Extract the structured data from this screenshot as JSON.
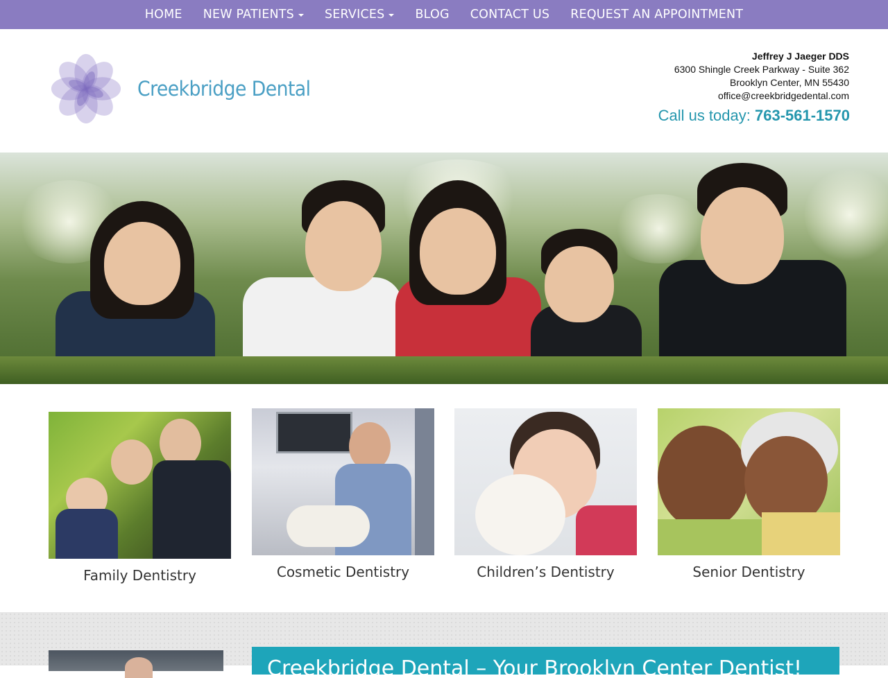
{
  "nav": {
    "items": [
      {
        "label": "HOME",
        "dropdown": false
      },
      {
        "label": "NEW PATIENTS",
        "dropdown": true
      },
      {
        "label": "SERVICES",
        "dropdown": true
      },
      {
        "label": "BLOG",
        "dropdown": false
      },
      {
        "label": "CONTACT US",
        "dropdown": false
      },
      {
        "label": "REQUEST AN APPOINTMENT",
        "dropdown": false
      }
    ]
  },
  "header": {
    "logo_text": "Creekbridge Dental",
    "doctor": "Jeffrey J Jaeger DDS",
    "address_line1": "6300 Shingle Creek Parkway - Suite 362",
    "address_line2": "Brooklyn Center, MN 55430",
    "email": "office@creekbridgedental.com",
    "call_label": "Call us today: ",
    "phone": "763-561-1570"
  },
  "services": [
    {
      "label": "Family Dentistry"
    },
    {
      "label": "Cosmetic Dentistry"
    },
    {
      "label": "Children’s Dentistry"
    },
    {
      "label": "Senior Dentistry"
    }
  ],
  "intro": {
    "heading": "Creekbridge Dental – Your Brooklyn Center Dentist!"
  },
  "colors": {
    "nav_bg": "#8a7cc1",
    "accent_teal": "#2496ad",
    "logo_text": "#4a9fc4",
    "banner_bg": "#1ea5ba"
  }
}
